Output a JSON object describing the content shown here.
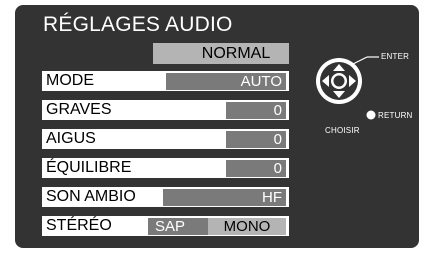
{
  "menu": {
    "title": "RÉGLAGES AUDIO",
    "preset": "NORMAL",
    "rows": [
      {
        "label": "MODE",
        "value": "AUTO"
      },
      {
        "label": "GRAVES",
        "value": "0"
      },
      {
        "label": "AIGUS",
        "value": "0"
      },
      {
        "label": "ÉQUILIBRE",
        "value": "0"
      },
      {
        "label": "SON AMBIO",
        "value": "HF"
      }
    ],
    "stereo": {
      "label": "STÉRÉO",
      "options": [
        "SAP",
        "MONO"
      ]
    }
  },
  "remote_hints": {
    "enter": "ENTER",
    "return": "RETURN",
    "choose": "CHOISIR"
  },
  "colors": {
    "background": "#333333",
    "row_bg": "#ffffff",
    "value_dark": "#7a7a7a",
    "value_light": "#b4b4b4"
  },
  "icons": [
    "navigation-pad-icon",
    "return-button-icon"
  ]
}
